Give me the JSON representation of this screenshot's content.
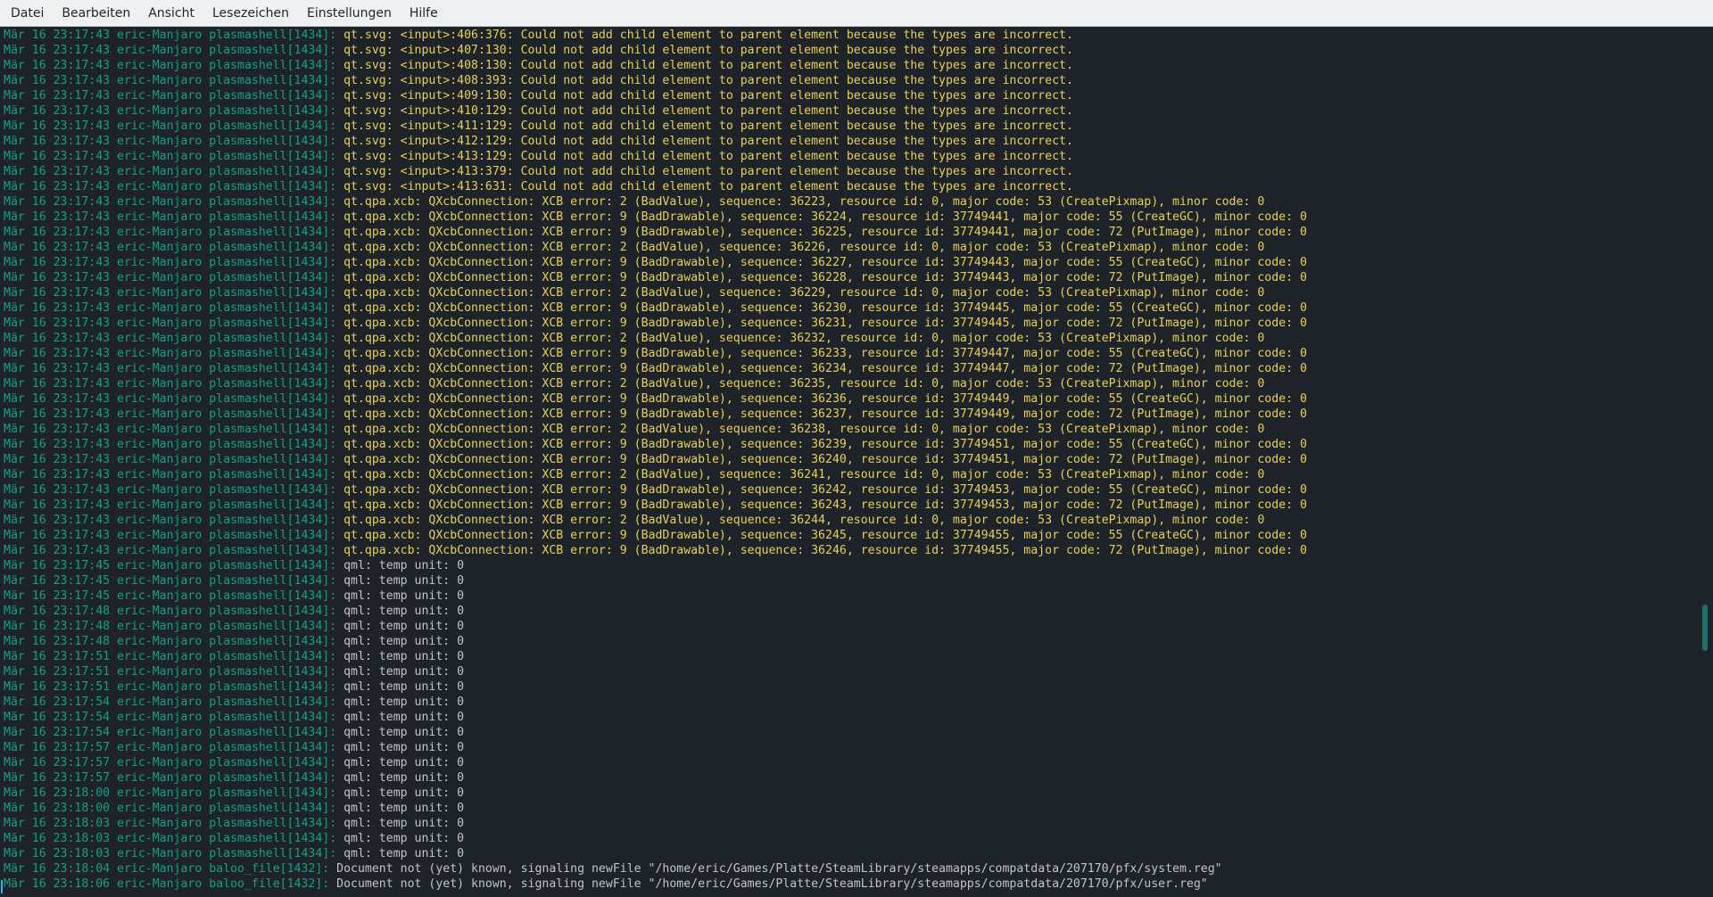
{
  "menu": [
    "Datei",
    "Bearbeiten",
    "Ansicht",
    "Lesezeichen",
    "Einstellungen",
    "Hilfe"
  ],
  "lines": [
    {
      "t": "Mär 16 23:17:43 eric-Manjaro plasmashell[1434]:",
      "m": " qt.svg: <input>:406:376: Could not add child element to parent element because the types are incorrect.",
      "k": "warn"
    },
    {
      "t": "Mär 16 23:17:43 eric-Manjaro plasmashell[1434]:",
      "m": " qt.svg: <input>:407:130: Could not add child element to parent element because the types are incorrect.",
      "k": "warn"
    },
    {
      "t": "Mär 16 23:17:43 eric-Manjaro plasmashell[1434]:",
      "m": " qt.svg: <input>:408:130: Could not add child element to parent element because the types are incorrect.",
      "k": "warn"
    },
    {
      "t": "Mär 16 23:17:43 eric-Manjaro plasmashell[1434]:",
      "m": " qt.svg: <input>:408:393: Could not add child element to parent element because the types are incorrect.",
      "k": "warn"
    },
    {
      "t": "Mär 16 23:17:43 eric-Manjaro plasmashell[1434]:",
      "m": " qt.svg: <input>:409:130: Could not add child element to parent element because the types are incorrect.",
      "k": "warn"
    },
    {
      "t": "Mär 16 23:17:43 eric-Manjaro plasmashell[1434]:",
      "m": " qt.svg: <input>:410:129: Could not add child element to parent element because the types are incorrect.",
      "k": "warn"
    },
    {
      "t": "Mär 16 23:17:43 eric-Manjaro plasmashell[1434]:",
      "m": " qt.svg: <input>:411:129: Could not add child element to parent element because the types are incorrect.",
      "k": "warn"
    },
    {
      "t": "Mär 16 23:17:43 eric-Manjaro plasmashell[1434]:",
      "m": " qt.svg: <input>:412:129: Could not add child element to parent element because the types are incorrect.",
      "k": "warn"
    },
    {
      "t": "Mär 16 23:17:43 eric-Manjaro plasmashell[1434]:",
      "m": " qt.svg: <input>:413:129: Could not add child element to parent element because the types are incorrect.",
      "k": "warn"
    },
    {
      "t": "Mär 16 23:17:43 eric-Manjaro plasmashell[1434]:",
      "m": " qt.svg: <input>:413:379: Could not add child element to parent element because the types are incorrect.",
      "k": "warn"
    },
    {
      "t": "Mär 16 23:17:43 eric-Manjaro plasmashell[1434]:",
      "m": " qt.svg: <input>:413:631: Could not add child element to parent element because the types are incorrect.",
      "k": "warn"
    },
    {
      "t": "Mär 16 23:17:43 eric-Manjaro plasmashell[1434]:",
      "m": " qt.qpa.xcb: QXcbConnection: XCB error: 2 (BadValue), sequence: 36223, resource id: 0, major code: 53 (CreatePixmap), minor code: 0",
      "k": "warn"
    },
    {
      "t": "Mär 16 23:17:43 eric-Manjaro plasmashell[1434]:",
      "m": " qt.qpa.xcb: QXcbConnection: XCB error: 9 (BadDrawable), sequence: 36224, resource id: 37749441, major code: 55 (CreateGC), minor code: 0",
      "k": "warn"
    },
    {
      "t": "Mär 16 23:17:43 eric-Manjaro plasmashell[1434]:",
      "m": " qt.qpa.xcb: QXcbConnection: XCB error: 9 (BadDrawable), sequence: 36225, resource id: 37749441, major code: 72 (PutImage), minor code: 0",
      "k": "warn"
    },
    {
      "t": "Mär 16 23:17:43 eric-Manjaro plasmashell[1434]:",
      "m": " qt.qpa.xcb: QXcbConnection: XCB error: 2 (BadValue), sequence: 36226, resource id: 0, major code: 53 (CreatePixmap), minor code: 0",
      "k": "warn"
    },
    {
      "t": "Mär 16 23:17:43 eric-Manjaro plasmashell[1434]:",
      "m": " qt.qpa.xcb: QXcbConnection: XCB error: 9 (BadDrawable), sequence: 36227, resource id: 37749443, major code: 55 (CreateGC), minor code: 0",
      "k": "warn"
    },
    {
      "t": "Mär 16 23:17:43 eric-Manjaro plasmashell[1434]:",
      "m": " qt.qpa.xcb: QXcbConnection: XCB error: 9 (BadDrawable), sequence: 36228, resource id: 37749443, major code: 72 (PutImage), minor code: 0",
      "k": "warn"
    },
    {
      "t": "Mär 16 23:17:43 eric-Manjaro plasmashell[1434]:",
      "m": " qt.qpa.xcb: QXcbConnection: XCB error: 2 (BadValue), sequence: 36229, resource id: 0, major code: 53 (CreatePixmap), minor code: 0",
      "k": "warn"
    },
    {
      "t": "Mär 16 23:17:43 eric-Manjaro plasmashell[1434]:",
      "m": " qt.qpa.xcb: QXcbConnection: XCB error: 9 (BadDrawable), sequence: 36230, resource id: 37749445, major code: 55 (CreateGC), minor code: 0",
      "k": "warn"
    },
    {
      "t": "Mär 16 23:17:43 eric-Manjaro plasmashell[1434]:",
      "m": " qt.qpa.xcb: QXcbConnection: XCB error: 9 (BadDrawable), sequence: 36231, resource id: 37749445, major code: 72 (PutImage), minor code: 0",
      "k": "warn"
    },
    {
      "t": "Mär 16 23:17:43 eric-Manjaro plasmashell[1434]:",
      "m": " qt.qpa.xcb: QXcbConnection: XCB error: 2 (BadValue), sequence: 36232, resource id: 0, major code: 53 (CreatePixmap), minor code: 0",
      "k": "warn"
    },
    {
      "t": "Mär 16 23:17:43 eric-Manjaro plasmashell[1434]:",
      "m": " qt.qpa.xcb: QXcbConnection: XCB error: 9 (BadDrawable), sequence: 36233, resource id: 37749447, major code: 55 (CreateGC), minor code: 0",
      "k": "warn"
    },
    {
      "t": "Mär 16 23:17:43 eric-Manjaro plasmashell[1434]:",
      "m": " qt.qpa.xcb: QXcbConnection: XCB error: 9 (BadDrawable), sequence: 36234, resource id: 37749447, major code: 72 (PutImage), minor code: 0",
      "k": "warn"
    },
    {
      "t": "Mär 16 23:17:43 eric-Manjaro plasmashell[1434]:",
      "m": " qt.qpa.xcb: QXcbConnection: XCB error: 2 (BadValue), sequence: 36235, resource id: 0, major code: 53 (CreatePixmap), minor code: 0",
      "k": "warn"
    },
    {
      "t": "Mär 16 23:17:43 eric-Manjaro plasmashell[1434]:",
      "m": " qt.qpa.xcb: QXcbConnection: XCB error: 9 (BadDrawable), sequence: 36236, resource id: 37749449, major code: 55 (CreateGC), minor code: 0",
      "k": "warn"
    },
    {
      "t": "Mär 16 23:17:43 eric-Manjaro plasmashell[1434]:",
      "m": " qt.qpa.xcb: QXcbConnection: XCB error: 9 (BadDrawable), sequence: 36237, resource id: 37749449, major code: 72 (PutImage), minor code: 0",
      "k": "warn"
    },
    {
      "t": "Mär 16 23:17:43 eric-Manjaro plasmashell[1434]:",
      "m": " qt.qpa.xcb: QXcbConnection: XCB error: 2 (BadValue), sequence: 36238, resource id: 0, major code: 53 (CreatePixmap), minor code: 0",
      "k": "warn"
    },
    {
      "t": "Mär 16 23:17:43 eric-Manjaro plasmashell[1434]:",
      "m": " qt.qpa.xcb: QXcbConnection: XCB error: 9 (BadDrawable), sequence: 36239, resource id: 37749451, major code: 55 (CreateGC), minor code: 0",
      "k": "warn"
    },
    {
      "t": "Mär 16 23:17:43 eric-Manjaro plasmashell[1434]:",
      "m": " qt.qpa.xcb: QXcbConnection: XCB error: 9 (BadDrawable), sequence: 36240, resource id: 37749451, major code: 72 (PutImage), minor code: 0",
      "k": "warn"
    },
    {
      "t": "Mär 16 23:17:43 eric-Manjaro plasmashell[1434]:",
      "m": " qt.qpa.xcb: QXcbConnection: XCB error: 2 (BadValue), sequence: 36241, resource id: 0, major code: 53 (CreatePixmap), minor code: 0",
      "k": "warn"
    },
    {
      "t": "Mär 16 23:17:43 eric-Manjaro plasmashell[1434]:",
      "m": " qt.qpa.xcb: QXcbConnection: XCB error: 9 (BadDrawable), sequence: 36242, resource id: 37749453, major code: 55 (CreateGC), minor code: 0",
      "k": "warn"
    },
    {
      "t": "Mär 16 23:17:43 eric-Manjaro plasmashell[1434]:",
      "m": " qt.qpa.xcb: QXcbConnection: XCB error: 9 (BadDrawable), sequence: 36243, resource id: 37749453, major code: 72 (PutImage), minor code: 0",
      "k": "warn"
    },
    {
      "t": "Mär 16 23:17:43 eric-Manjaro plasmashell[1434]:",
      "m": " qt.qpa.xcb: QXcbConnection: XCB error: 2 (BadValue), sequence: 36244, resource id: 0, major code: 53 (CreatePixmap), minor code: 0",
      "k": "warn"
    },
    {
      "t": "Mär 16 23:17:43 eric-Manjaro plasmashell[1434]:",
      "m": " qt.qpa.xcb: QXcbConnection: XCB error: 9 (BadDrawable), sequence: 36245, resource id: 37749455, major code: 55 (CreateGC), minor code: 0",
      "k": "warn"
    },
    {
      "t": "Mär 16 23:17:43 eric-Manjaro plasmashell[1434]:",
      "m": " qt.qpa.xcb: QXcbConnection: XCB error: 9 (BadDrawable), sequence: 36246, resource id: 37749455, major code: 72 (PutImage), minor code: 0",
      "k": "warn"
    },
    {
      "t": "Mär 16 23:17:45 eric-Manjaro plasmashell[1434]:",
      "m": " qml: temp unit: 0",
      "k": "normal"
    },
    {
      "t": "Mär 16 23:17:45 eric-Manjaro plasmashell[1434]:",
      "m": " qml: temp unit: 0",
      "k": "normal"
    },
    {
      "t": "Mär 16 23:17:45 eric-Manjaro plasmashell[1434]:",
      "m": " qml: temp unit: 0",
      "k": "normal"
    },
    {
      "t": "Mär 16 23:17:48 eric-Manjaro plasmashell[1434]:",
      "m": " qml: temp unit: 0",
      "k": "normal"
    },
    {
      "t": "Mär 16 23:17:48 eric-Manjaro plasmashell[1434]:",
      "m": " qml: temp unit: 0",
      "k": "normal"
    },
    {
      "t": "Mär 16 23:17:48 eric-Manjaro plasmashell[1434]:",
      "m": " qml: temp unit: 0",
      "k": "normal"
    },
    {
      "t": "Mär 16 23:17:51 eric-Manjaro plasmashell[1434]:",
      "m": " qml: temp unit: 0",
      "k": "normal"
    },
    {
      "t": "Mär 16 23:17:51 eric-Manjaro plasmashell[1434]:",
      "m": " qml: temp unit: 0",
      "k": "normal"
    },
    {
      "t": "Mär 16 23:17:51 eric-Manjaro plasmashell[1434]:",
      "m": " qml: temp unit: 0",
      "k": "normal"
    },
    {
      "t": "Mär 16 23:17:54 eric-Manjaro plasmashell[1434]:",
      "m": " qml: temp unit: 0",
      "k": "normal"
    },
    {
      "t": "Mär 16 23:17:54 eric-Manjaro plasmashell[1434]:",
      "m": " qml: temp unit: 0",
      "k": "normal"
    },
    {
      "t": "Mär 16 23:17:54 eric-Manjaro plasmashell[1434]:",
      "m": " qml: temp unit: 0",
      "k": "normal"
    },
    {
      "t": "Mär 16 23:17:57 eric-Manjaro plasmashell[1434]:",
      "m": " qml: temp unit: 0",
      "k": "normal"
    },
    {
      "t": "Mär 16 23:17:57 eric-Manjaro plasmashell[1434]:",
      "m": " qml: temp unit: 0",
      "k": "normal"
    },
    {
      "t": "Mär 16 23:17:57 eric-Manjaro plasmashell[1434]:",
      "m": " qml: temp unit: 0",
      "k": "normal"
    },
    {
      "t": "Mär 16 23:18:00 eric-Manjaro plasmashell[1434]:",
      "m": " qml: temp unit: 0",
      "k": "normal"
    },
    {
      "t": "Mär 16 23:18:00 eric-Manjaro plasmashell[1434]:",
      "m": " qml: temp unit: 0",
      "k": "normal"
    },
    {
      "t": "Mär 16 23:18:03 eric-Manjaro plasmashell[1434]:",
      "m": " qml: temp unit: 0",
      "k": "normal"
    },
    {
      "t": "Mär 16 23:18:03 eric-Manjaro plasmashell[1434]:",
      "m": " qml: temp unit: 0",
      "k": "normal"
    },
    {
      "t": "Mär 16 23:18:03 eric-Manjaro plasmashell[1434]:",
      "m": " qml: temp unit: 0",
      "k": "normal"
    },
    {
      "t": "Mär 16 23:18:04 eric-Manjaro baloo_file[1432]:",
      "m": " Document not (yet) known, signaling newFile \"/home/eric/Games/Platte/SteamLibrary/steamapps/compatdata/207170/pfx/system.reg\"",
      "k": "normal"
    },
    {
      "t": "Mär 16 23:18:06 eric-Manjaro baloo_file[1432]:",
      "m": " Document not (yet) known, signaling newFile \"/home/eric/Games/Platte/SteamLibrary/steamapps/compatdata/207170/pfx/user.reg\"",
      "k": "normal"
    }
  ]
}
